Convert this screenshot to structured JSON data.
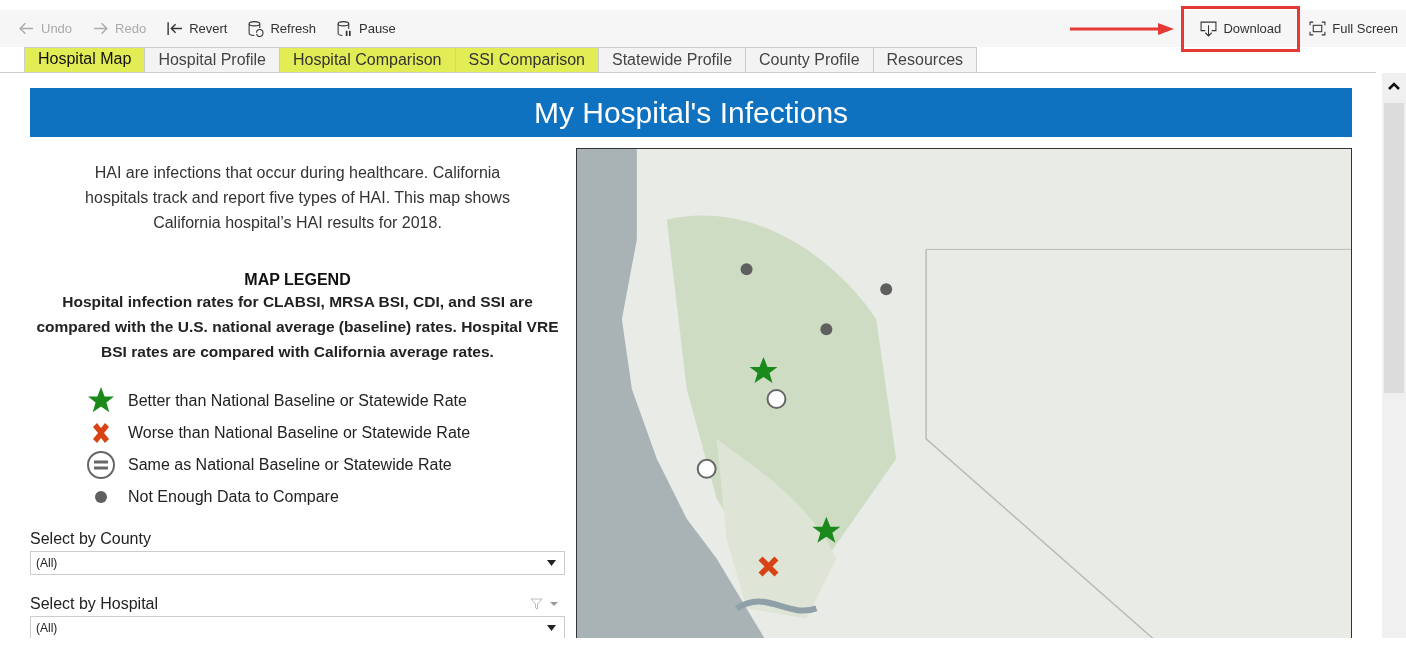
{
  "toolbar": [
    {
      "kind": "undo",
      "label": "Undo",
      "disabled": true,
      "annotated": false
    },
    {
      "kind": "redo",
      "label": "Redo",
      "disabled": true,
      "annotated": false
    },
    {
      "kind": "revert",
      "label": "Revert",
      "disabled": false,
      "annotated": false
    },
    {
      "kind": "refresh",
      "label": "Refresh",
      "disabled": false,
      "annotated": false
    },
    {
      "kind": "pause",
      "label": "Pause",
      "disabled": false,
      "annotated": false
    },
    {
      "kind": "download",
      "label": "Download",
      "disabled": false,
      "annotated": true
    },
    {
      "kind": "fullscreen",
      "label": "Full Screen",
      "disabled": false,
      "annotated": false
    }
  ],
  "tabs": [
    {
      "label": "Hospital Map",
      "selected": true,
      "highlighted": true
    },
    {
      "label": "Hospital Profile",
      "selected": false,
      "highlighted": false
    },
    {
      "label": "Hospital Comparison",
      "selected": false,
      "highlighted": true
    },
    {
      "label": "SSI Comparison",
      "selected": false,
      "highlighted": true
    },
    {
      "label": "Statewide Profile",
      "selected": false,
      "highlighted": false
    },
    {
      "label": "County Profile",
      "selected": false,
      "highlighted": false
    },
    {
      "label": "Resources",
      "selected": false,
      "highlighted": false
    }
  ],
  "banner": {
    "title": "My Hospital's Infections"
  },
  "intro": "HAI are infections that occur during healthcare. California hospitals track and report five types of HAI. This map shows California hospital’s HAI results for 2018.",
  "legend": {
    "title": "MAP LEGEND",
    "description": "Hospital infection rates for CLABSI, MRSA BSI, CDI, and SSI are compared with the U.S. national average (baseline) rates. Hospital VRE BSI rates are compared with California average rates.",
    "items": [
      {
        "kind": "better",
        "label": "Better than National Baseline or Statewide Rate",
        "color": "#1a8a1a"
      },
      {
        "kind": "worse",
        "label": "Worse than National Baseline or Statewide Rate",
        "color": "#d84315"
      },
      {
        "kind": "same",
        "label": "Same as National Baseline or Statewide Rate",
        "color": "#666666"
      },
      {
        "kind": "nodata",
        "label": "Not Enough Data to Compare",
        "color": "#5f5f5f"
      }
    ]
  },
  "filters": [
    {
      "label": "Select by County",
      "value": "(All)",
      "filter_icon": false
    },
    {
      "label": "Select by Hospital",
      "value": "(All)",
      "filter_icon": true
    }
  ]
}
